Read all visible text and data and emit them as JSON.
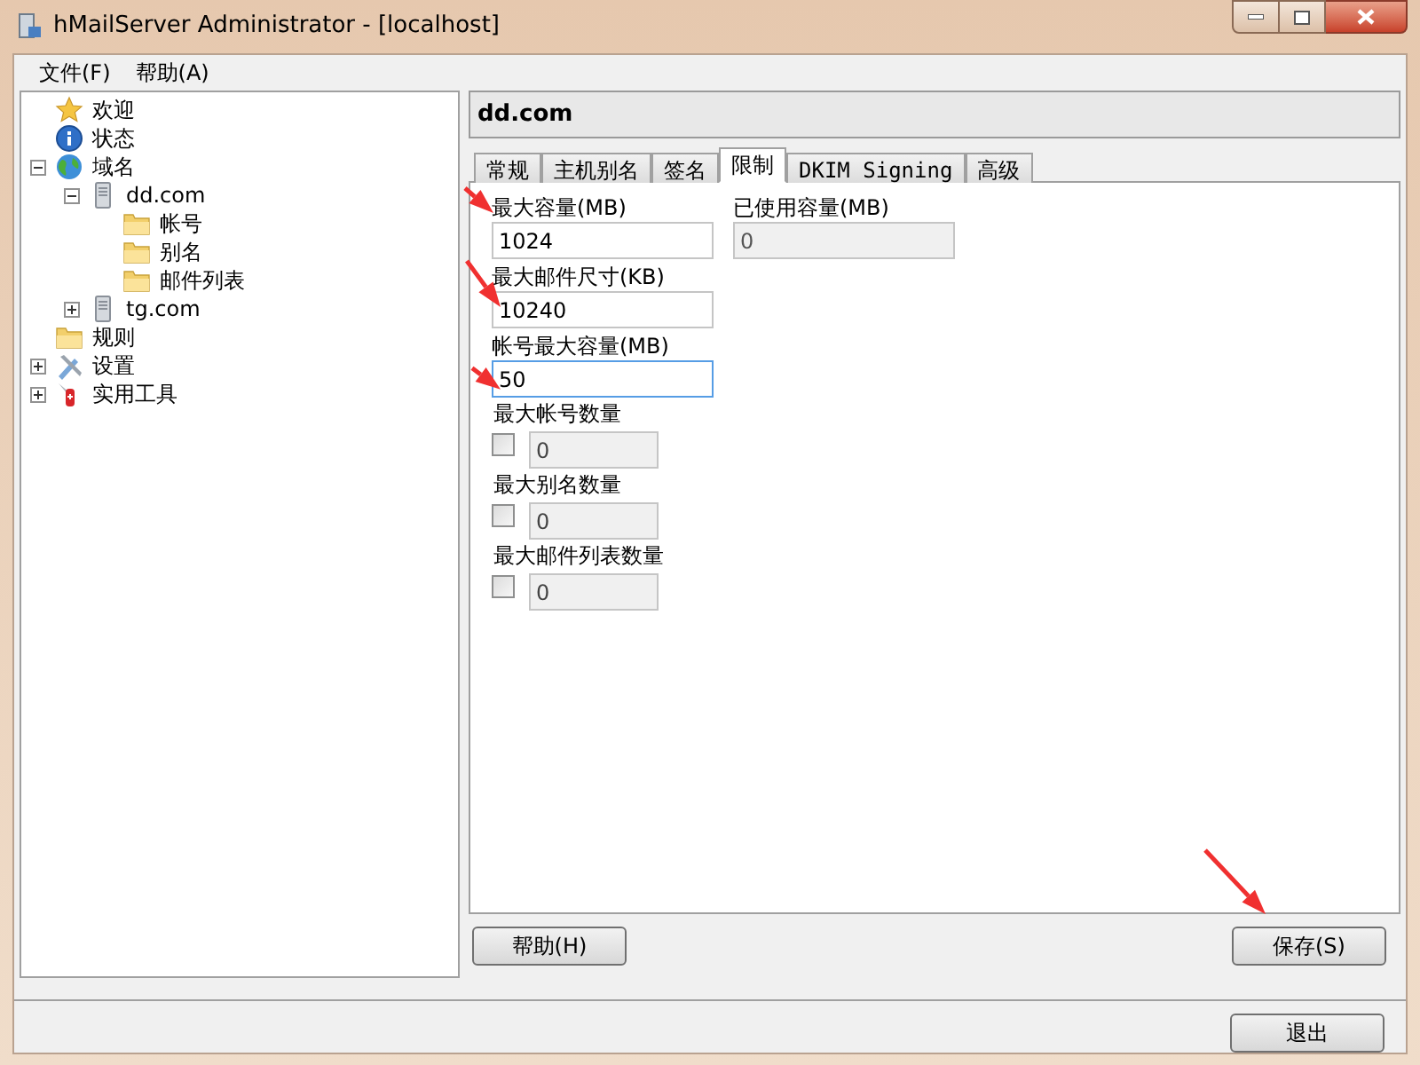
{
  "window": {
    "title": "hMailServer Administrator - [localhost]"
  },
  "menu": [
    "文件(F)",
    "帮助(A)"
  ],
  "tree": [
    {
      "label": "欢迎",
      "kind": "star"
    },
    {
      "label": "状态",
      "kind": "info"
    },
    {
      "label": "域名",
      "kind": "globe",
      "expanded": true,
      "children": [
        {
          "label": "dd.com",
          "kind": "server",
          "expanded": true,
          "children": [
            {
              "label": "帐号",
              "kind": "folder"
            },
            {
              "label": "别名",
              "kind": "folder"
            },
            {
              "label": "邮件列表",
              "kind": "folder"
            }
          ]
        },
        {
          "label": "tg.com",
          "kind": "server",
          "expanded": false
        }
      ]
    },
    {
      "label": "规则",
      "kind": "folder"
    },
    {
      "label": "设置",
      "kind": "tools",
      "expanded": false
    },
    {
      "label": "实用工具",
      "kind": "knife",
      "expanded": false
    }
  ],
  "panel": {
    "title": "dd.com",
    "tabs": [
      {
        "label": "常规",
        "selected": false
      },
      {
        "label": "主机别名",
        "selected": false
      },
      {
        "label": "签名",
        "selected": false
      },
      {
        "label": "限制",
        "selected": true
      },
      {
        "label": "DKIM Signing",
        "selected": false
      },
      {
        "label": "高级",
        "selected": false
      }
    ],
    "rows": [
      [
        {
          "kind": "text",
          "label": "最大容量(MB)",
          "value": "1024",
          "disabled": false,
          "focused": false
        },
        {
          "kind": "text",
          "label": "已使用容量(MB)",
          "value": "0",
          "disabled": true,
          "focused": false
        }
      ],
      [
        {
          "kind": "text",
          "label": "最大邮件尺寸(KB)",
          "value": "10240",
          "disabled": false,
          "focused": false
        }
      ],
      [
        {
          "kind": "text",
          "label": "帐号最大容量(MB)",
          "value": "50",
          "disabled": false,
          "focused": true
        }
      ],
      [
        {
          "kind": "check",
          "label": "最大帐号数量",
          "value": "0",
          "checked": false,
          "disabled": true
        }
      ],
      [
        {
          "kind": "check",
          "label": "最大别名数量",
          "value": "0",
          "checked": false,
          "disabled": true
        }
      ],
      [
        {
          "kind": "check",
          "label": "最大邮件列表数量",
          "value": "0",
          "checked": false,
          "disabled": true
        }
      ]
    ],
    "help_button": "帮助(H)",
    "save_button": "保存(S)"
  },
  "exit_button": "退出"
}
